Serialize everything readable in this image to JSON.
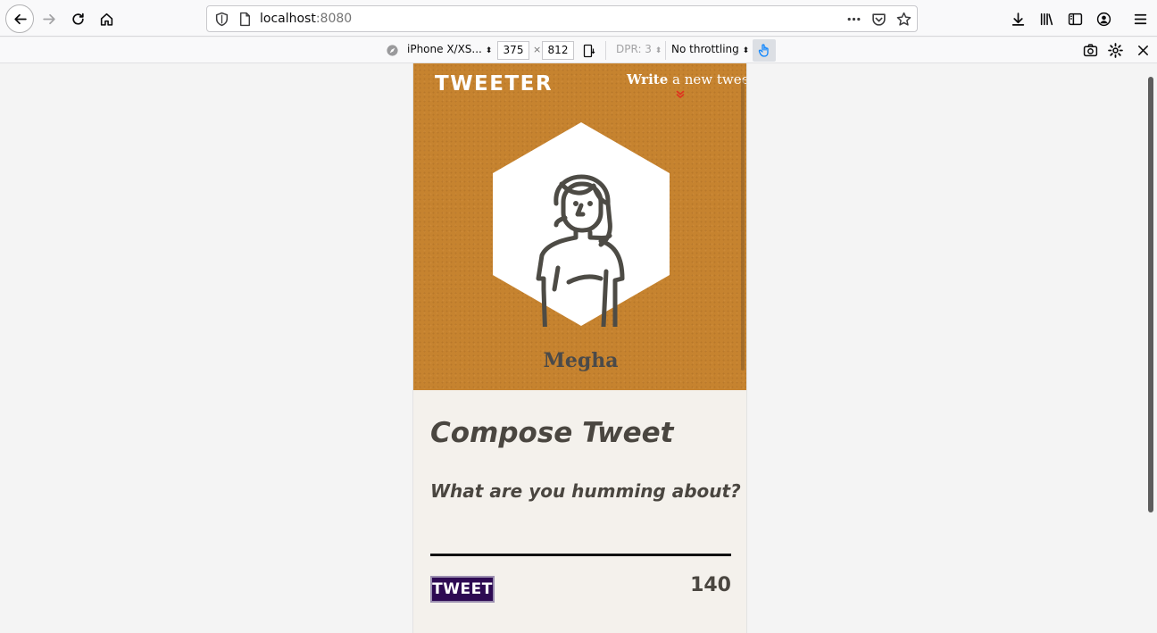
{
  "browser": {
    "url_host": "localhost",
    "url_port": ":8080"
  },
  "rdm": {
    "device": "iPhone X/XS...",
    "width": "375",
    "times": "×",
    "height": "812",
    "dpr": "DPR: 3",
    "throttling": "No throttling"
  },
  "page": {
    "logo": "TWEETER",
    "write_bold": "Write",
    "write_rest": " a new tweet",
    "username": "Megha",
    "compose_title": "Compose Tweet",
    "compose_placeholder": "What are you humming about?",
    "tweet_button": "TWEET",
    "char_counter": "140"
  },
  "colors": {
    "header_bg": "#c6832f",
    "tweet_button_bg": "#2d0a52",
    "chevron": "#e0301e"
  }
}
